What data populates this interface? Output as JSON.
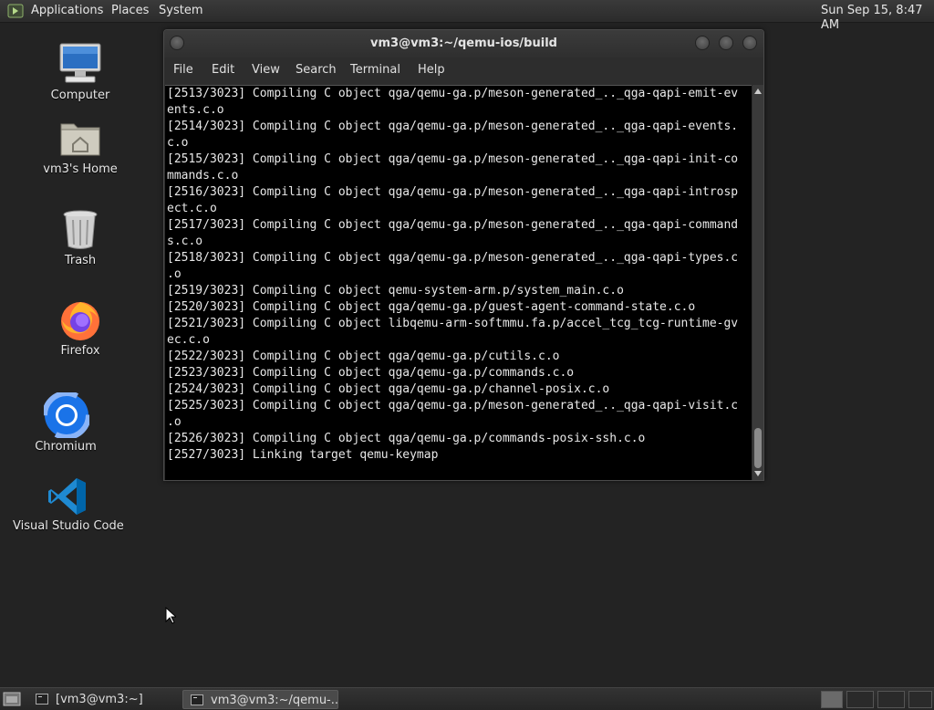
{
  "top_panel": {
    "menus": [
      "Applications",
      "Places",
      "System"
    ],
    "clock": "Sun Sep 15,  8:47 AM"
  },
  "desktop": {
    "icons": [
      {
        "label": "Computer",
        "icon": "computer-icon"
      },
      {
        "label": "vm3's Home",
        "icon": "home-folder-icon"
      },
      {
        "label": "Trash",
        "icon": "trash-icon"
      },
      {
        "label": "Firefox",
        "icon": "firefox-icon"
      },
      {
        "label": "Chromium",
        "icon": "chromium-icon"
      },
      {
        "label": "Visual Studio Code",
        "icon": "vscode-icon"
      }
    ]
  },
  "terminal": {
    "title": "vm3@vm3:~/qemu-ios/build",
    "menu": [
      "File",
      "Edit",
      "View",
      "Search",
      "Terminal",
      "Help"
    ],
    "lines": [
      "[2513/3023] Compiling C object qga/qemu-ga.p/meson-generated_.._qga-qapi-emit-ev",
      "ents.c.o",
      "[2514/3023] Compiling C object qga/qemu-ga.p/meson-generated_.._qga-qapi-events.",
      "c.o",
      "[2515/3023] Compiling C object qga/qemu-ga.p/meson-generated_.._qga-qapi-init-co",
      "mmands.c.o",
      "[2516/3023] Compiling C object qga/qemu-ga.p/meson-generated_.._qga-qapi-introsp",
      "ect.c.o",
      "[2517/3023] Compiling C object qga/qemu-ga.p/meson-generated_.._qga-qapi-command",
      "s.c.o",
      "[2518/3023] Compiling C object qga/qemu-ga.p/meson-generated_.._qga-qapi-types.c",
      ".o",
      "[2519/3023] Compiling C object qemu-system-arm.p/system_main.c.o",
      "[2520/3023] Compiling C object qga/qemu-ga.p/guest-agent-command-state.c.o",
      "[2521/3023] Compiling C object libqemu-arm-softmmu.fa.p/accel_tcg_tcg-runtime-gv",
      "ec.c.o",
      "[2522/3023] Compiling C object qga/qemu-ga.p/cutils.c.o",
      "[2523/3023] Compiling C object qga/qemu-ga.p/commands.c.o",
      "[2524/3023] Compiling C object qga/qemu-ga.p/channel-posix.c.o",
      "[2525/3023] Compiling C object qga/qemu-ga.p/meson-generated_.._qga-qapi-visit.c",
      ".o",
      "[2526/3023] Compiling C object qga/qemu-ga.p/commands-posix-ssh.c.o",
      "[2527/3023] Linking target qemu-keymap"
    ]
  },
  "taskbar": {
    "tasks": [
      "[vm3@vm3:~]",
      "vm3@vm3:~/qemu-..."
    ]
  }
}
